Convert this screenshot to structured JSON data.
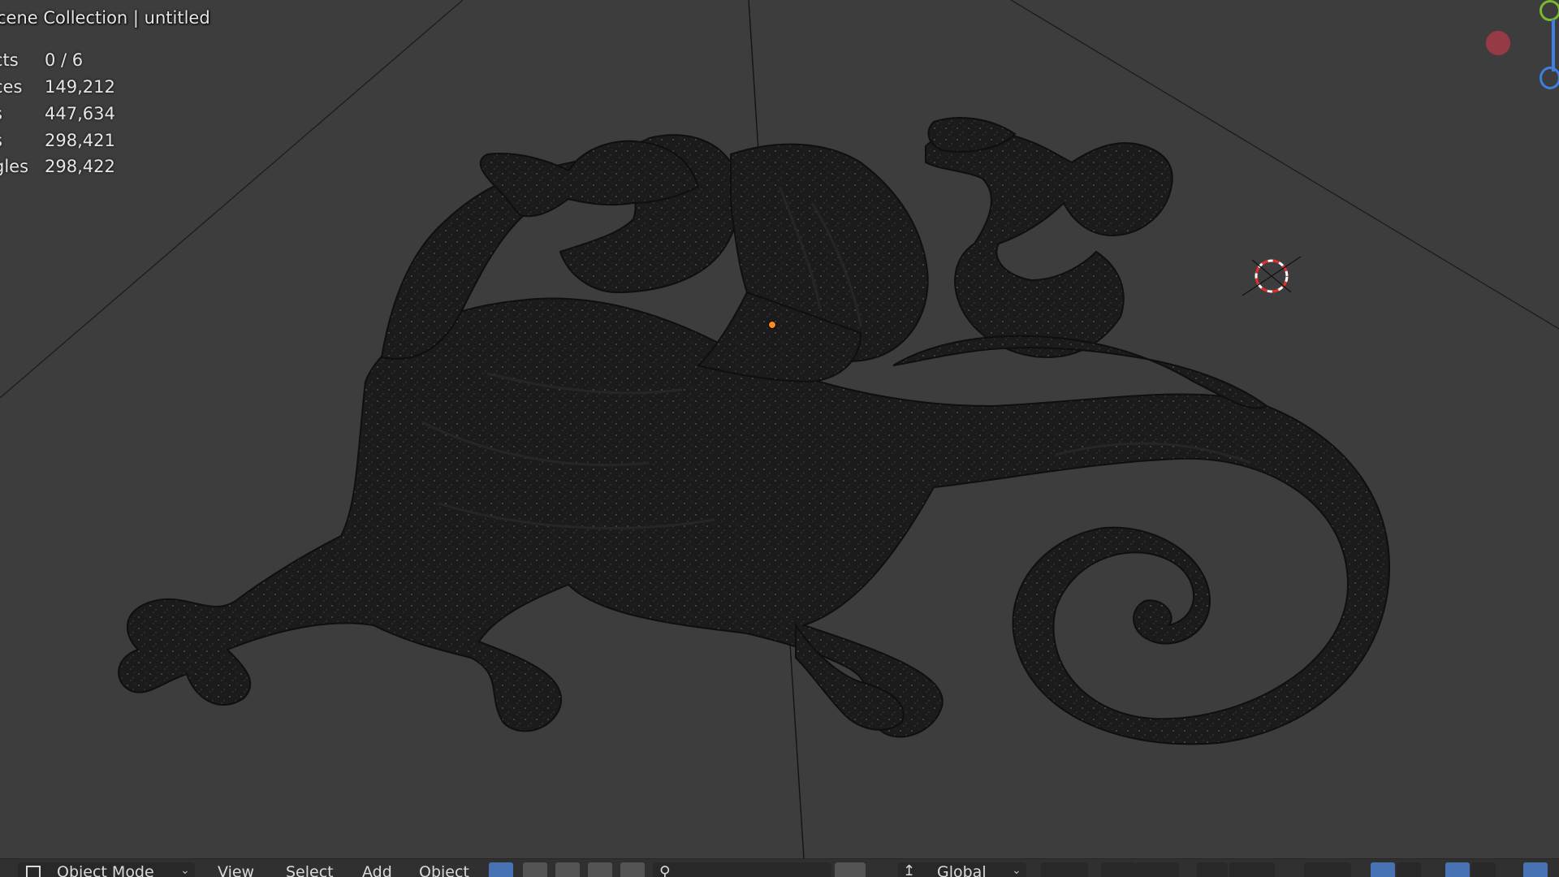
{
  "viewport": {
    "collection_title": "cene Collection | untitled",
    "stats": [
      {
        "label": "cts",
        "value": "0 / 6"
      },
      {
        "label": "ces",
        "value": "149,212"
      },
      {
        "label": "s",
        "value": "447,634"
      },
      {
        "label": "s",
        "value": "298,421"
      },
      {
        "label": "gles",
        "value": "298,422"
      }
    ]
  },
  "header": {
    "mode_label": "Object Mode",
    "menus": [
      "View",
      "Select",
      "Add",
      "Object"
    ],
    "transform_orientation": "Global"
  },
  "colors": {
    "background": "#3d3d3d",
    "model": "#1c1c1c",
    "origin": "#ff8c1a",
    "cursor_red": "#e0302f",
    "gizmo_x": "#e03b4c",
    "gizmo_y": "#7bba2e",
    "gizmo_z": "#3f7fe0",
    "active_button": "#4772b3"
  },
  "icons": {
    "cursor": "3d-cursor-icon",
    "origin": "object-origin-icon",
    "search": "search-icon",
    "transform": "transform-orientation-icon"
  }
}
